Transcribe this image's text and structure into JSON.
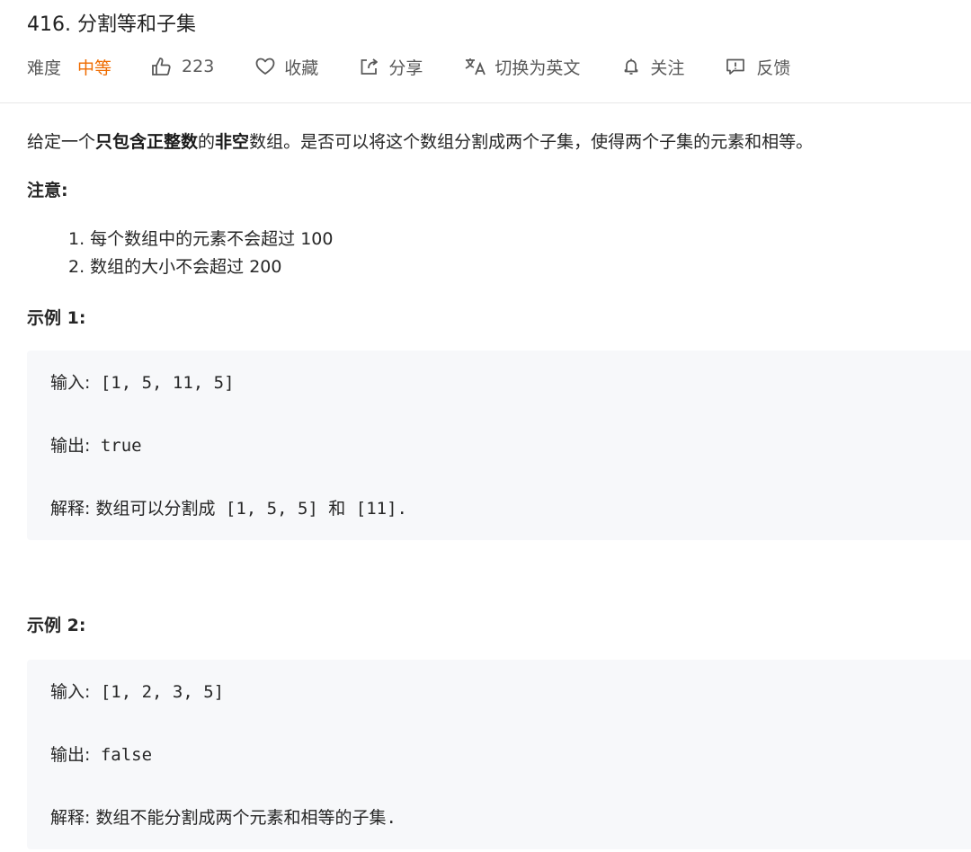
{
  "problem": {
    "title": "416. 分割等和子集",
    "difficulty_label": "难度",
    "difficulty_value": "中等",
    "likes": "223",
    "favorite_label": "收藏",
    "share_label": "分享",
    "translate_label": "切换为英文",
    "follow_label": "关注",
    "feedback_label": "反馈",
    "difficulty_color": "#ef6c00"
  },
  "description": {
    "p1_a": "给定一个",
    "p1_b": "只包含正整数",
    "p1_c": "的",
    "p1_d": "非空",
    "p1_e": "数组。是否可以将这个数组分割成两个子集，使得两个子集的元素和相等。",
    "note_heading": "注意:",
    "notes": [
      "1. 每个数组中的元素不会超过 100",
      "2. 数组的大小不会超过 200"
    ]
  },
  "examples": [
    {
      "heading": "示例 1:",
      "input_label": "输入:",
      "input_value": " [1, 5, 11, 5]",
      "output_label": "输出:",
      "output_value": " true",
      "explain_label": "解释:",
      "explain_text1": " 数组可以分割成",
      "explain_code1": " [1, 5, 5] ",
      "explain_text2": "和",
      "explain_code2": " [11]."
    },
    {
      "heading": "示例 2:",
      "input_label": "输入:",
      "input_value": " [1, 2, 3, 5]",
      "output_label": "输出:",
      "output_value": " false",
      "explain_label": "解释:",
      "explain_text1": " 数组不能分割成两个元素和相等的子集",
      "explain_code1": "."
    }
  ],
  "icons": {
    "like": "thumbs-up-icon",
    "favorite": "heart-icon",
    "share": "share-icon",
    "translate": "translate-icon",
    "follow": "bell-icon",
    "feedback": "feedback-icon"
  }
}
